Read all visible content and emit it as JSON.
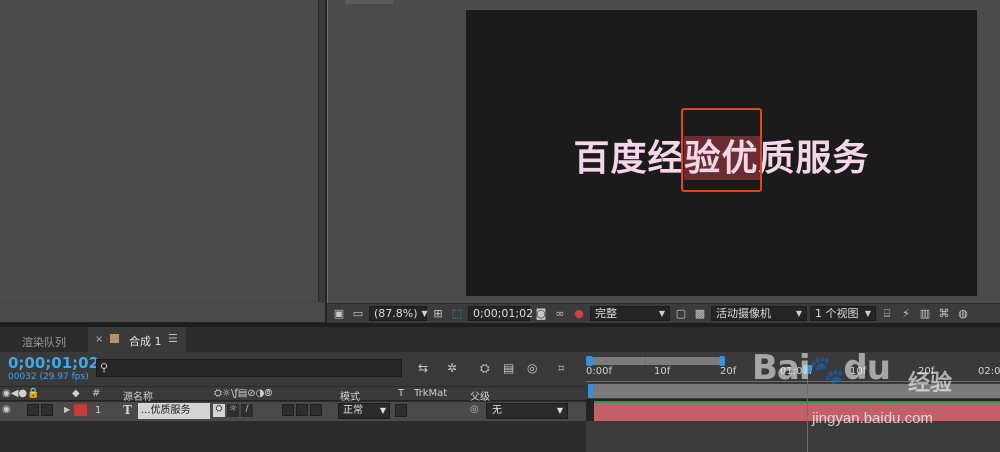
{
  "viewer": {
    "canvas_text": "百度经验优质服务",
    "zoom": "(87.8%)",
    "timecode": "0;00;01;02",
    "resolution": "完整",
    "camera": "活动摄像机",
    "views": "1 个视图"
  },
  "tabs": [
    {
      "label": "渲染队列"
    },
    {
      "label": "合成 1",
      "close": "×",
      "menu": "☰"
    }
  ],
  "timeline": {
    "timecode": "0;00;01;02",
    "frames": "00032 (29.97 fps)",
    "search_icon": "⚲",
    "ruler": [
      "0:00f",
      "10f",
      "20f",
      "01:00f",
      "10f",
      "20f",
      "02:00"
    ],
    "columns": {
      "hash": "#",
      "source_name": "源名称",
      "mode": "模式",
      "t": "T",
      "trkmat": "TrkMat",
      "parent": "父级"
    },
    "layer": {
      "number": "1",
      "type_icon": "T",
      "name": "...优质服务",
      "mode": "正常",
      "parent": "无"
    }
  },
  "watermark": {
    "logo": "Bai",
    "logo_suffix": "du",
    "text": "经验",
    "url": "jingyan.baidu.com"
  },
  "colors": {
    "accent": "#3ea8e8",
    "selection": "#e2461c",
    "layer_label": "#c33c3c",
    "layer_bar": "#c2606a"
  }
}
